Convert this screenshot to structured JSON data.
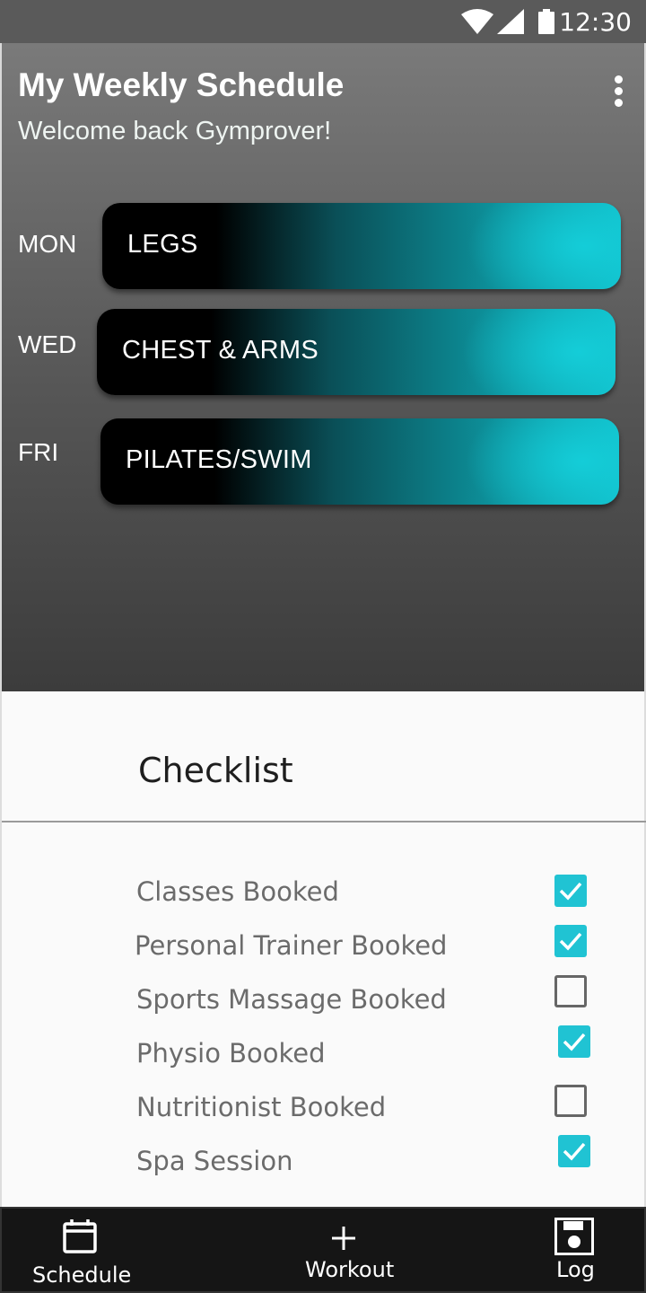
{
  "status_bar": {
    "time": "12:30",
    "icons": [
      "wifi-icon",
      "signal-icon",
      "battery-icon"
    ]
  },
  "header": {
    "title": "My Weekly Schedule",
    "subtitle": "Welcome back Gymprover!",
    "menu_icon": "more-vertical-icon"
  },
  "schedule": [
    {
      "day": "MON",
      "workout": "LEGS"
    },
    {
      "day": "WED",
      "workout": "CHEST & ARMS"
    },
    {
      "day": "FRI",
      "workout": "PILATES/SWIM"
    }
  ],
  "checklist": {
    "title": "Checklist",
    "items": [
      {
        "label": "Classes Booked",
        "checked": true
      },
      {
        "label": "Personal Trainer Booked",
        "checked": true
      },
      {
        "label": "Sports Massage Booked",
        "checked": false
      },
      {
        "label": "Physio Booked",
        "checked": true
      },
      {
        "label": "Nutritionist Booked",
        "checked": false
      },
      {
        "label": "Spa Session",
        "checked": true
      }
    ]
  },
  "nav": {
    "items": [
      {
        "label": "Schedule",
        "icon": "calendar-icon"
      },
      {
        "label": "Workout",
        "icon": "plus-icon"
      },
      {
        "label": "Log",
        "icon": "save-icon"
      }
    ]
  },
  "colors": {
    "accent": "#20c3d3",
    "pill_end": "#14cdd8",
    "nav_bg": "#151515"
  }
}
